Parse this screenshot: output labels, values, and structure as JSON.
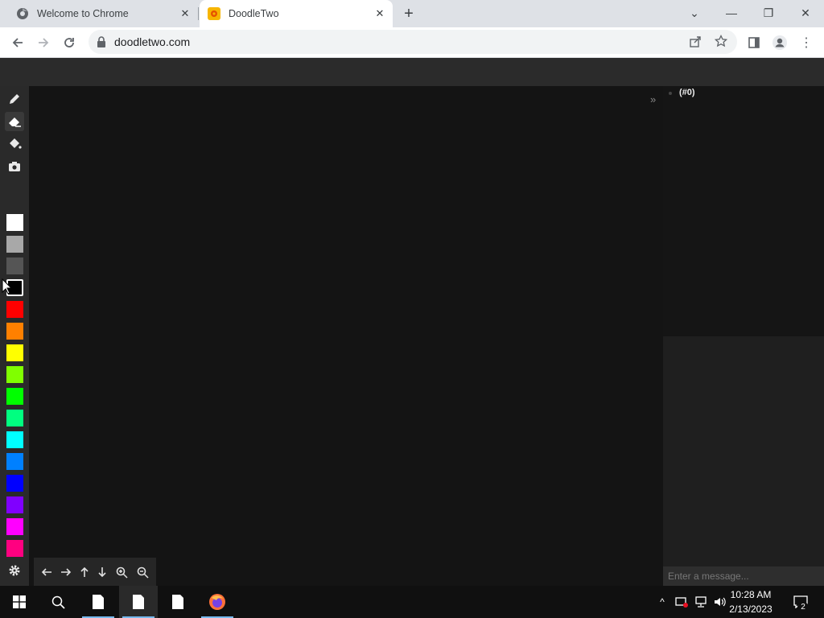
{
  "browser": {
    "tabs": [
      {
        "title": "Welcome to Chrome",
        "icon": "chrome-icon",
        "active": false
      },
      {
        "title": "DoodleTwo",
        "icon": "doodletwo-favicon",
        "active": true
      }
    ],
    "url": "doodletwo.com"
  },
  "app": {
    "tools": [
      "pencil-icon",
      "eraser-icon",
      "paint-bucket-icon",
      "camera-icon"
    ],
    "selected_tool": "eraser-icon",
    "palette": [
      "#ffffff",
      "#a8a8a8",
      "#555555",
      "#000000",
      "#ff0000",
      "#ff8000",
      "#ffff00",
      "#80ff00",
      "#00ff00",
      "#00ff80",
      "#00ffff",
      "#0080ff",
      "#0000ff",
      "#8000ff",
      "#ff00ff",
      "#ff0080"
    ],
    "selected_color": "#000000",
    "collapse_label": "»",
    "user_label": "(#0)",
    "chat_placeholder": "Enter a message...",
    "nav_controls": [
      "arrow-left-icon",
      "arrow-right-icon",
      "arrow-up-icon",
      "arrow-down-icon",
      "zoom-in-icon",
      "zoom-out-icon"
    ]
  },
  "taskbar": {
    "time": "10:28 AM",
    "date": "2/13/2023",
    "notification_count": "2"
  }
}
